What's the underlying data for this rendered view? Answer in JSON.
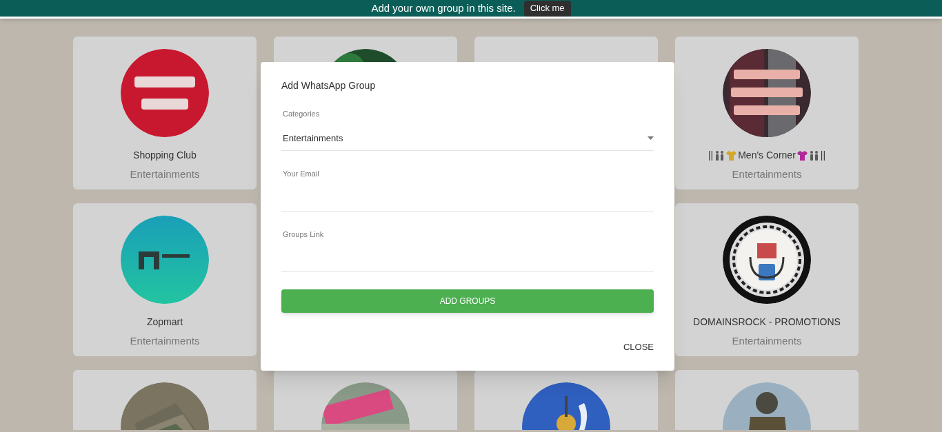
{
  "banner": {
    "text": "Add your own group in this site.",
    "button": "Click me"
  },
  "cards": [
    {
      "kind": "group",
      "name": [
        {
          "kind": "text",
          "text": "Shopping Club"
        }
      ],
      "category": "Entertainments"
    },
    {
      "kind": "picture"
    },
    {
      "kind": "blank"
    },
    {
      "kind": "group",
      "name": [
        {
          "kind": "text",
          "text": "||"
        },
        {
          "kind": "people"
        },
        {
          "kind": "shirt",
          "color": "#d4a82a"
        },
        {
          "kind": "text",
          "text": "Men's Corner"
        },
        {
          "kind": "shirt",
          "color": "#b0289a"
        },
        {
          "kind": "people"
        },
        {
          "kind": "text",
          "text": "||"
        }
      ],
      "category": "Entertainments"
    },
    {
      "kind": "group",
      "name": [
        {
          "kind": "text",
          "text": "Zopmart"
        }
      ],
      "category": "Entertainments"
    },
    {
      "kind": "group",
      "name": [
        {
          "kind": "text",
          "text": "DOMAINSROCK - PROMOTIONS"
        }
      ],
      "category": "Entertainments"
    },
    {
      "kind": "picture"
    },
    {
      "kind": "picture"
    },
    {
      "kind": "picture"
    },
    {
      "kind": "picture"
    }
  ],
  "dialog": {
    "title": "Add WhatsApp Group",
    "fields": [
      {
        "kind": "select",
        "label": "Categories",
        "value": "Entertainments"
      },
      {
        "kind": "input",
        "label": "Your Email"
      },
      {
        "kind": "input",
        "label": "Groups Link"
      }
    ],
    "submit": "ADD GROUPS",
    "close": "CLOSE"
  }
}
